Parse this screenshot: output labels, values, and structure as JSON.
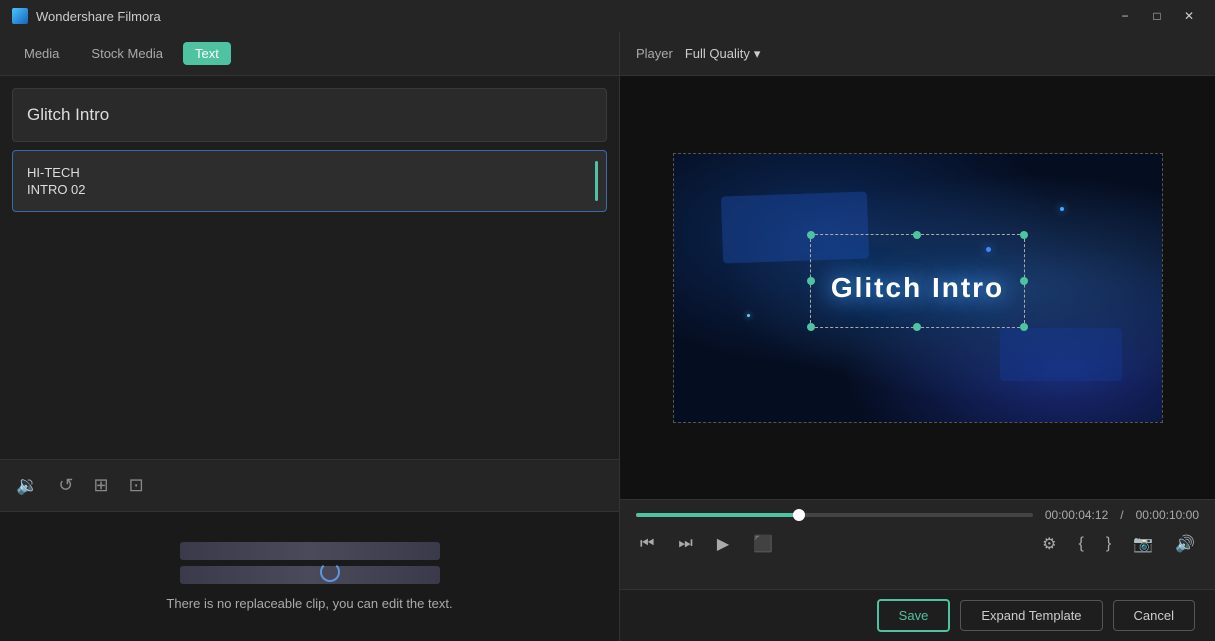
{
  "app": {
    "title": "Wondershare Filmora"
  },
  "titlebar": {
    "title": "Wondershare Filmora",
    "minimize_label": "−",
    "maximize_label": "□",
    "close_label": "✕"
  },
  "tabs": {
    "media_label": "Media",
    "stock_media_label": "Stock Media",
    "text_label": "Text"
  },
  "player": {
    "label": "Player",
    "quality": "Full Quality"
  },
  "template_list": {
    "glitch_intro": "Glitch Intro",
    "item1_line1": "HI-TECH",
    "item1_line2": "INTRO 02"
  },
  "video": {
    "title_text": "Glitch Intro"
  },
  "timeline": {
    "no_clip_text": "There is no replaceable clip, you can edit the text."
  },
  "time": {
    "current": "00:00:04:12",
    "separator": "/",
    "total": "00:00:10:00"
  },
  "actions": {
    "save_label": "Save",
    "expand_template_label": "Expand Template",
    "cancel_label": "Cancel"
  },
  "controls": {
    "rewind": "⏪",
    "step_back": "⏮",
    "play": "▶",
    "stop": "⬛",
    "settings_icon": "⚙",
    "bracket_left": "{",
    "bracket_right": "}",
    "camera": "📷",
    "volume": "🔊"
  }
}
